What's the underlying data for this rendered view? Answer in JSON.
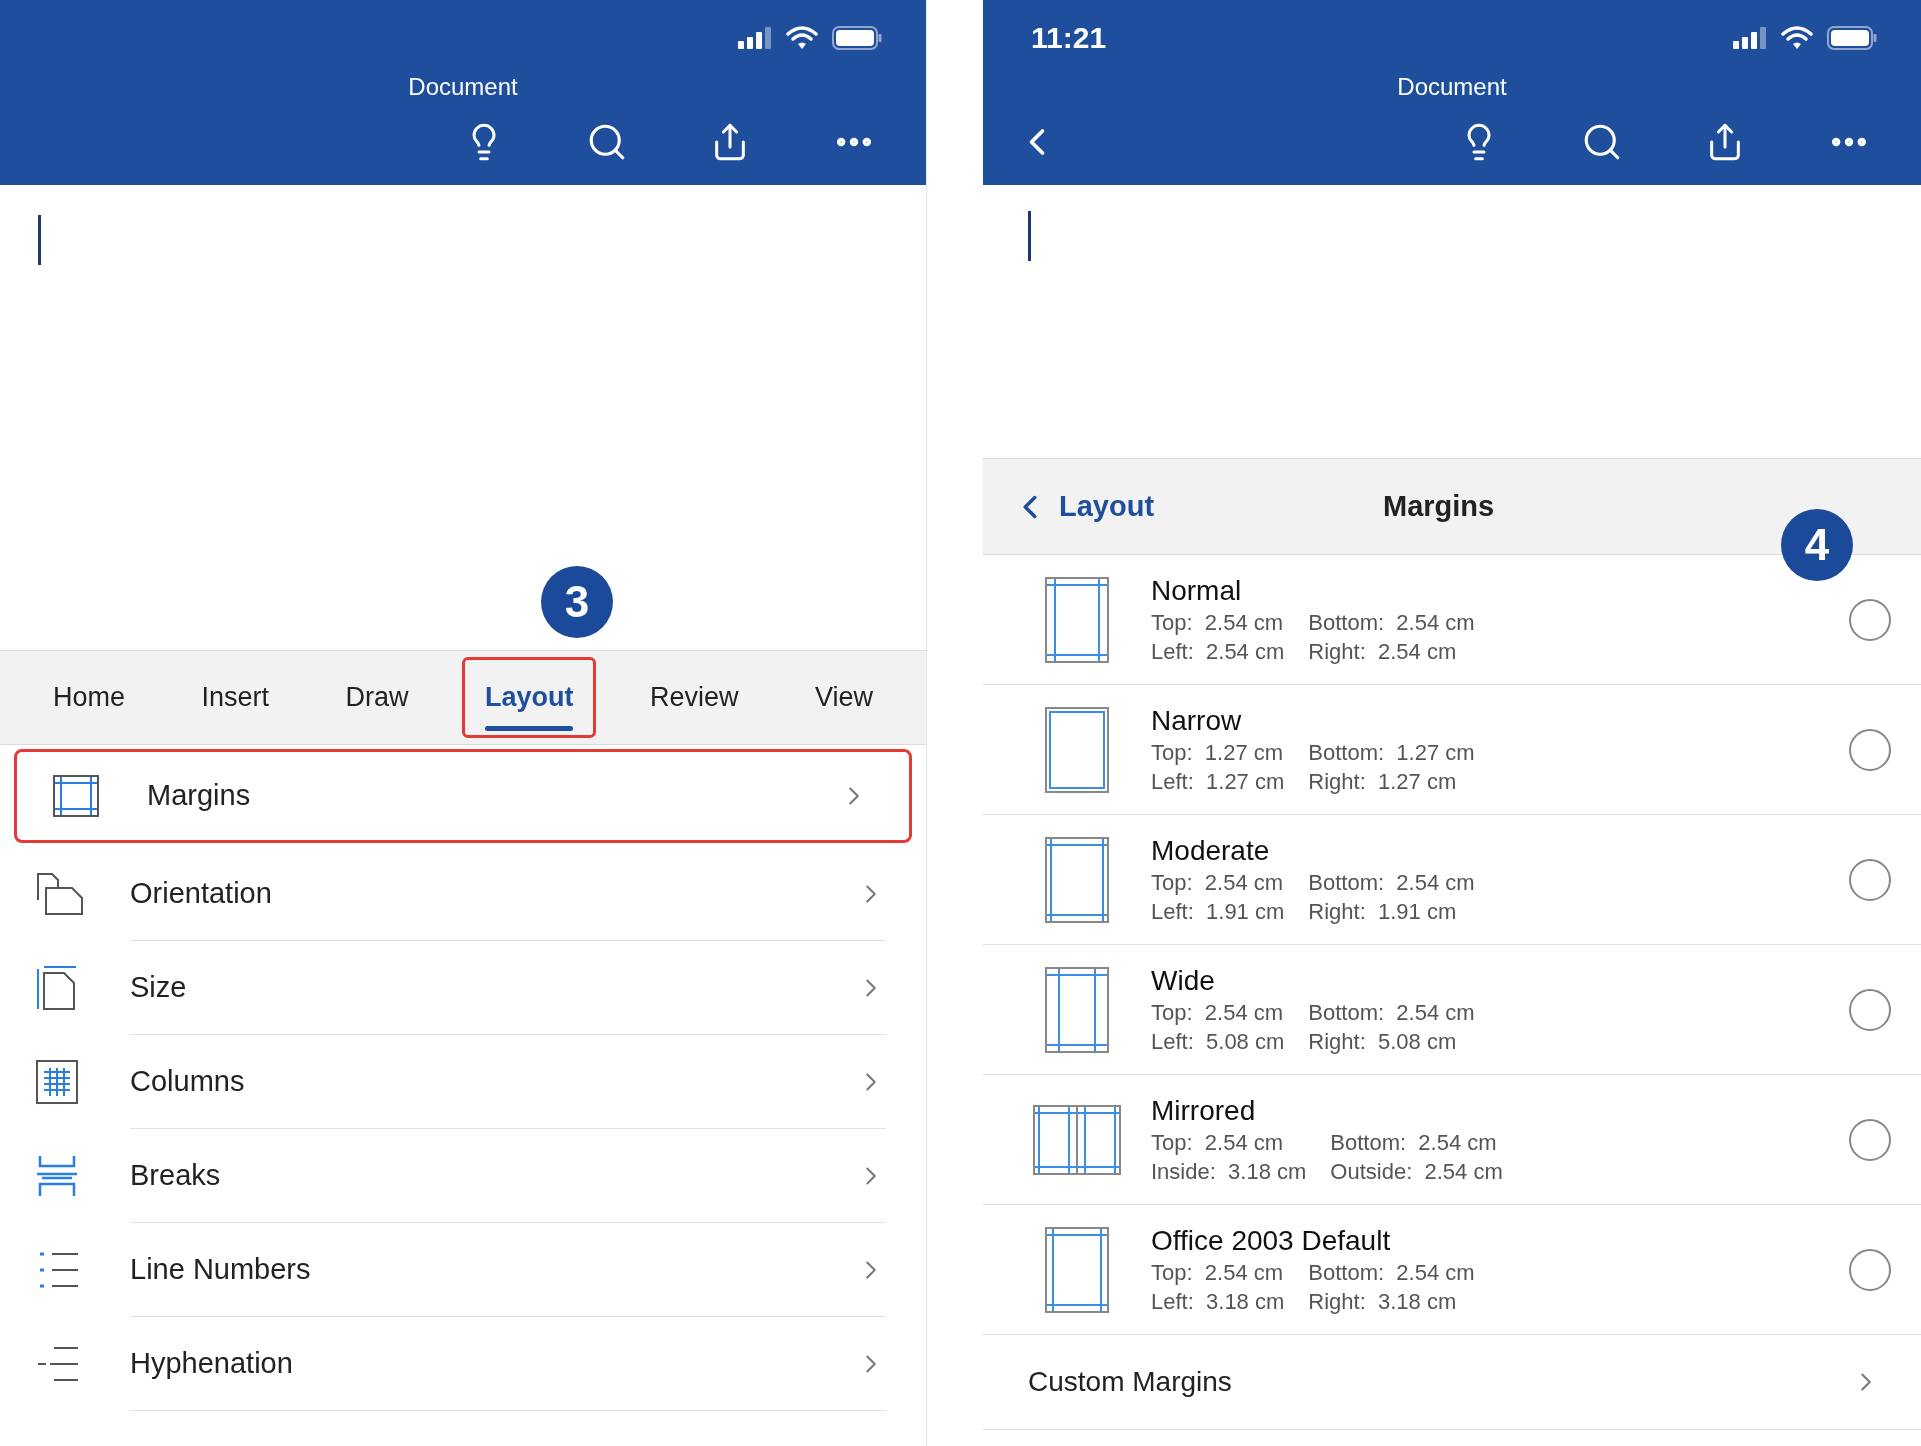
{
  "left_screen": {
    "header": {
      "title": "Document"
    },
    "step_badge": "3",
    "ribbon_tabs": [
      {
        "label": "Home",
        "selected": false,
        "highlighted": false
      },
      {
        "label": "Insert",
        "selected": false,
        "highlighted": false
      },
      {
        "label": "Draw",
        "selected": false,
        "highlighted": false
      },
      {
        "label": "Layout",
        "selected": true,
        "highlighted": true
      },
      {
        "label": "Review",
        "selected": false,
        "highlighted": false
      },
      {
        "label": "View",
        "selected": false,
        "highlighted": false
      }
    ],
    "layout_menu": [
      {
        "kind": "margins",
        "label": "Margins",
        "highlighted": true
      },
      {
        "kind": "orientation",
        "label": "Orientation",
        "highlighted": false
      },
      {
        "kind": "size",
        "label": "Size",
        "highlighted": false
      },
      {
        "kind": "columns",
        "label": "Columns",
        "highlighted": false
      },
      {
        "kind": "breaks",
        "label": "Breaks",
        "highlighted": false
      },
      {
        "kind": "line-numbers",
        "label": "Line Numbers",
        "highlighted": false
      },
      {
        "kind": "hyphenation",
        "label": "Hyphenation",
        "highlighted": false
      }
    ]
  },
  "right_screen": {
    "status_bar": {
      "time": "11:21"
    },
    "header": {
      "title": "Document"
    },
    "panel": {
      "back_label": "Layout",
      "title": "Margins"
    },
    "step_badge": "4",
    "margin_presets": [
      {
        "kind": "normal",
        "name": "Normal",
        "selected": false,
        "lines": [
          {
            "first": "Top:  2.54 cm",
            "second": "Bottom:  2.54 cm"
          },
          {
            "first": "Left:  2.54 cm",
            "second": "Right:  2.54 cm"
          }
        ]
      },
      {
        "kind": "narrow",
        "name": "Narrow",
        "selected": false,
        "lines": [
          {
            "first": "Top:  1.27 cm",
            "second": "Bottom:  1.27 cm"
          },
          {
            "first": "Left:  1.27 cm",
            "second": "Right:  1.27 cm"
          }
        ]
      },
      {
        "kind": "moderate",
        "name": "Moderate",
        "selected": false,
        "lines": [
          {
            "first": "Top:  2.54 cm",
            "second": "Bottom:  2.54 cm"
          },
          {
            "first": "Left:  1.91 cm",
            "second": "Right:  1.91 cm"
          }
        ]
      },
      {
        "kind": "wide",
        "name": "Wide",
        "selected": false,
        "lines": [
          {
            "first": "Top:  2.54 cm",
            "second": "Bottom:  2.54 cm"
          },
          {
            "first": "Left:  5.08 cm",
            "second": "Right:  5.08 cm"
          }
        ]
      },
      {
        "kind": "mirrored",
        "name": "Mirrored",
        "selected": false,
        "lines": [
          {
            "first": "Top:  2.54 cm",
            "second": "Bottom:  2.54 cm"
          },
          {
            "first": "Inside:  3.18 cm",
            "second": "Outside:  2.54 cm"
          }
        ]
      },
      {
        "kind": "office",
        "name": "Office 2003 Default",
        "selected": false,
        "lines": [
          {
            "first": "Top:  2.54 cm",
            "second": "Bottom:  2.54 cm"
          },
          {
            "first": "Left:  3.18 cm",
            "second": "Right:  3.18 cm"
          }
        ]
      }
    ],
    "custom": {
      "label": "Custom Margins"
    }
  }
}
